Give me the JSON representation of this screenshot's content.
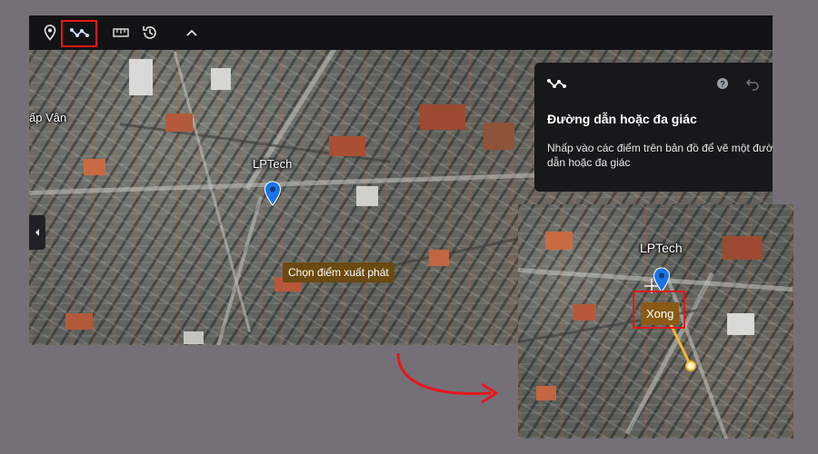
{
  "toolbar": {
    "icons": [
      "pin-icon",
      "path-icon",
      "ruler-icon",
      "history-icon",
      "chevron-up-icon"
    ]
  },
  "main_map": {
    "place_label": "LPTech",
    "edge_label": "ấp Vân",
    "tooltip": "Chọn điểm xuất phát"
  },
  "panel": {
    "icon": "path-icon",
    "title": "Đường dẫn hoặc đa giác",
    "desc_line1": "Nhấp vào các điểm trên bản đồ để vẽ một đường",
    "desc_line2": "dẫn hoặc đa giác"
  },
  "inset": {
    "place_label": "LPTech",
    "done_label": "Xong"
  },
  "colors": {
    "highlight": "#e8161b",
    "arrow": "#e8161b",
    "pin": "#1a73e8",
    "path_line": "#f2b43a",
    "tooltip_bg": "#6a4a10"
  }
}
